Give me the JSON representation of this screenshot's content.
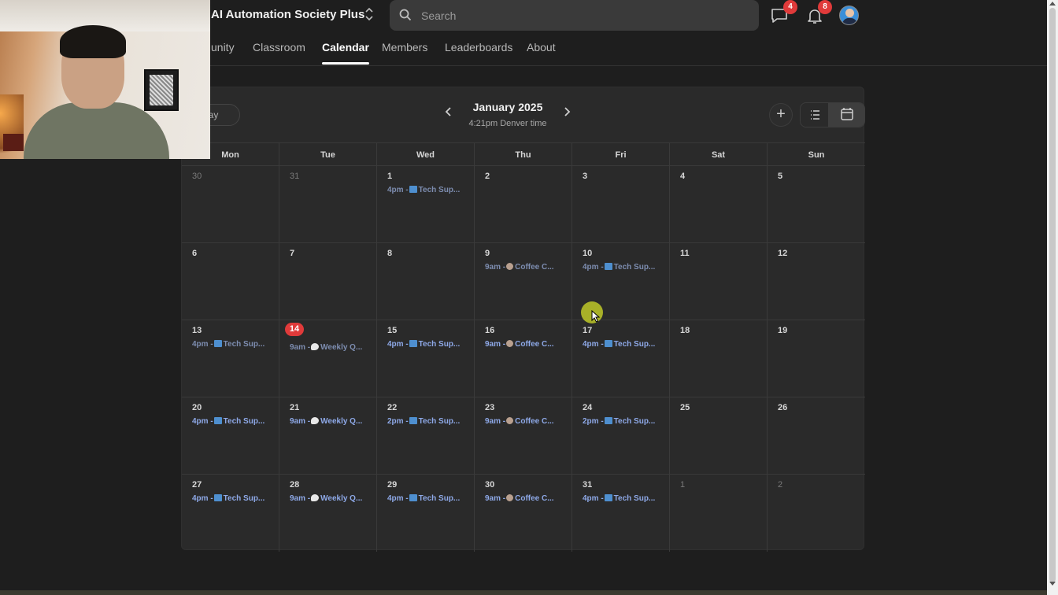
{
  "header": {
    "group_name": "AI Automation Society Plus",
    "search_placeholder": "Search",
    "chat_badge": "4",
    "notifications_badge": "8"
  },
  "tabs": [
    {
      "label": "unity",
      "active": false
    },
    {
      "label": "Classroom",
      "active": false
    },
    {
      "label": "Calendar",
      "active": true
    },
    {
      "label": "Members",
      "active": false
    },
    {
      "label": "Leaderboards",
      "active": false
    },
    {
      "label": "About",
      "active": false
    }
  ],
  "calendar": {
    "today_label": "day",
    "month_title": "January 2025",
    "timezone_note": "4:21pm Denver time",
    "add_label": "+",
    "weekdays": [
      "Mon",
      "Tue",
      "Wed",
      "Thu",
      "Fri",
      "Sat",
      "Sun"
    ],
    "weeks": [
      [
        {
          "day": "30",
          "muted": true,
          "events": []
        },
        {
          "day": "31",
          "muted": true,
          "events": []
        },
        {
          "day": "1",
          "events": [
            {
              "time": "4pm -",
              "icon": "laptop",
              "title": "Tech Sup...",
              "past": true
            }
          ]
        },
        {
          "day": "2",
          "events": []
        },
        {
          "day": "3",
          "events": []
        },
        {
          "day": "4",
          "events": []
        },
        {
          "day": "5",
          "events": []
        }
      ],
      [
        {
          "day": "6",
          "events": []
        },
        {
          "day": "7",
          "events": []
        },
        {
          "day": "8",
          "events": []
        },
        {
          "day": "9",
          "events": [
            {
              "time": "9am -",
              "icon": "coffee",
              "title": "Coffee C...",
              "past": true
            }
          ]
        },
        {
          "day": "10",
          "events": [
            {
              "time": "4pm -",
              "icon": "laptop",
              "title": "Tech Sup...",
              "past": true
            }
          ]
        },
        {
          "day": "11",
          "events": []
        },
        {
          "day": "12",
          "events": []
        }
      ],
      [
        {
          "day": "13",
          "events": [
            {
              "time": "4pm -",
              "icon": "laptop",
              "title": "Tech Sup...",
              "past": true
            }
          ]
        },
        {
          "day": "14",
          "today": true,
          "events": [
            {
              "time": "9am -",
              "icon": "bubble",
              "title": "Weekly Q...",
              "past": true
            }
          ]
        },
        {
          "day": "15",
          "events": [
            {
              "time": "4pm -",
              "icon": "laptop",
              "title": "Tech Sup..."
            }
          ]
        },
        {
          "day": "16",
          "events": [
            {
              "time": "9am -",
              "icon": "coffee",
              "title": "Coffee C..."
            }
          ]
        },
        {
          "day": "17",
          "events": [
            {
              "time": "4pm -",
              "icon": "laptop",
              "title": "Tech Sup..."
            }
          ]
        },
        {
          "day": "18",
          "events": []
        },
        {
          "day": "19",
          "events": []
        }
      ],
      [
        {
          "day": "20",
          "events": [
            {
              "time": "4pm -",
              "icon": "laptop",
              "title": "Tech Sup..."
            }
          ]
        },
        {
          "day": "21",
          "events": [
            {
              "time": "9am -",
              "icon": "bubble",
              "title": "Weekly Q..."
            }
          ]
        },
        {
          "day": "22",
          "events": [
            {
              "time": "2pm -",
              "icon": "laptop",
              "title": "Tech Sup..."
            }
          ]
        },
        {
          "day": "23",
          "events": [
            {
              "time": "9am -",
              "icon": "coffee",
              "title": "Coffee C..."
            }
          ]
        },
        {
          "day": "24",
          "events": [
            {
              "time": "2pm -",
              "icon": "laptop",
              "title": "Tech Sup..."
            }
          ]
        },
        {
          "day": "25",
          "events": []
        },
        {
          "day": "26",
          "events": []
        }
      ],
      [
        {
          "day": "27",
          "events": [
            {
              "time": "4pm -",
              "icon": "laptop",
              "title": "Tech Sup..."
            }
          ]
        },
        {
          "day": "28",
          "events": [
            {
              "time": "9am -",
              "icon": "bubble",
              "title": "Weekly Q..."
            }
          ]
        },
        {
          "day": "29",
          "events": [
            {
              "time": "4pm -",
              "icon": "laptop",
              "title": "Tech Sup..."
            }
          ]
        },
        {
          "day": "30",
          "events": [
            {
              "time": "9am -",
              "icon": "coffee",
              "title": "Coffee C..."
            }
          ]
        },
        {
          "day": "31",
          "events": [
            {
              "time": "4pm -",
              "icon": "laptop",
              "title": "Tech Sup..."
            }
          ]
        },
        {
          "day": "1",
          "muted": true,
          "events": []
        },
        {
          "day": "2",
          "muted": true,
          "events": []
        }
      ]
    ]
  },
  "colors": {
    "background": "#1e1e1e",
    "card": "#2a2a2a",
    "accent_red": "#e03a3a",
    "event_blue": "#8ea9e8"
  }
}
